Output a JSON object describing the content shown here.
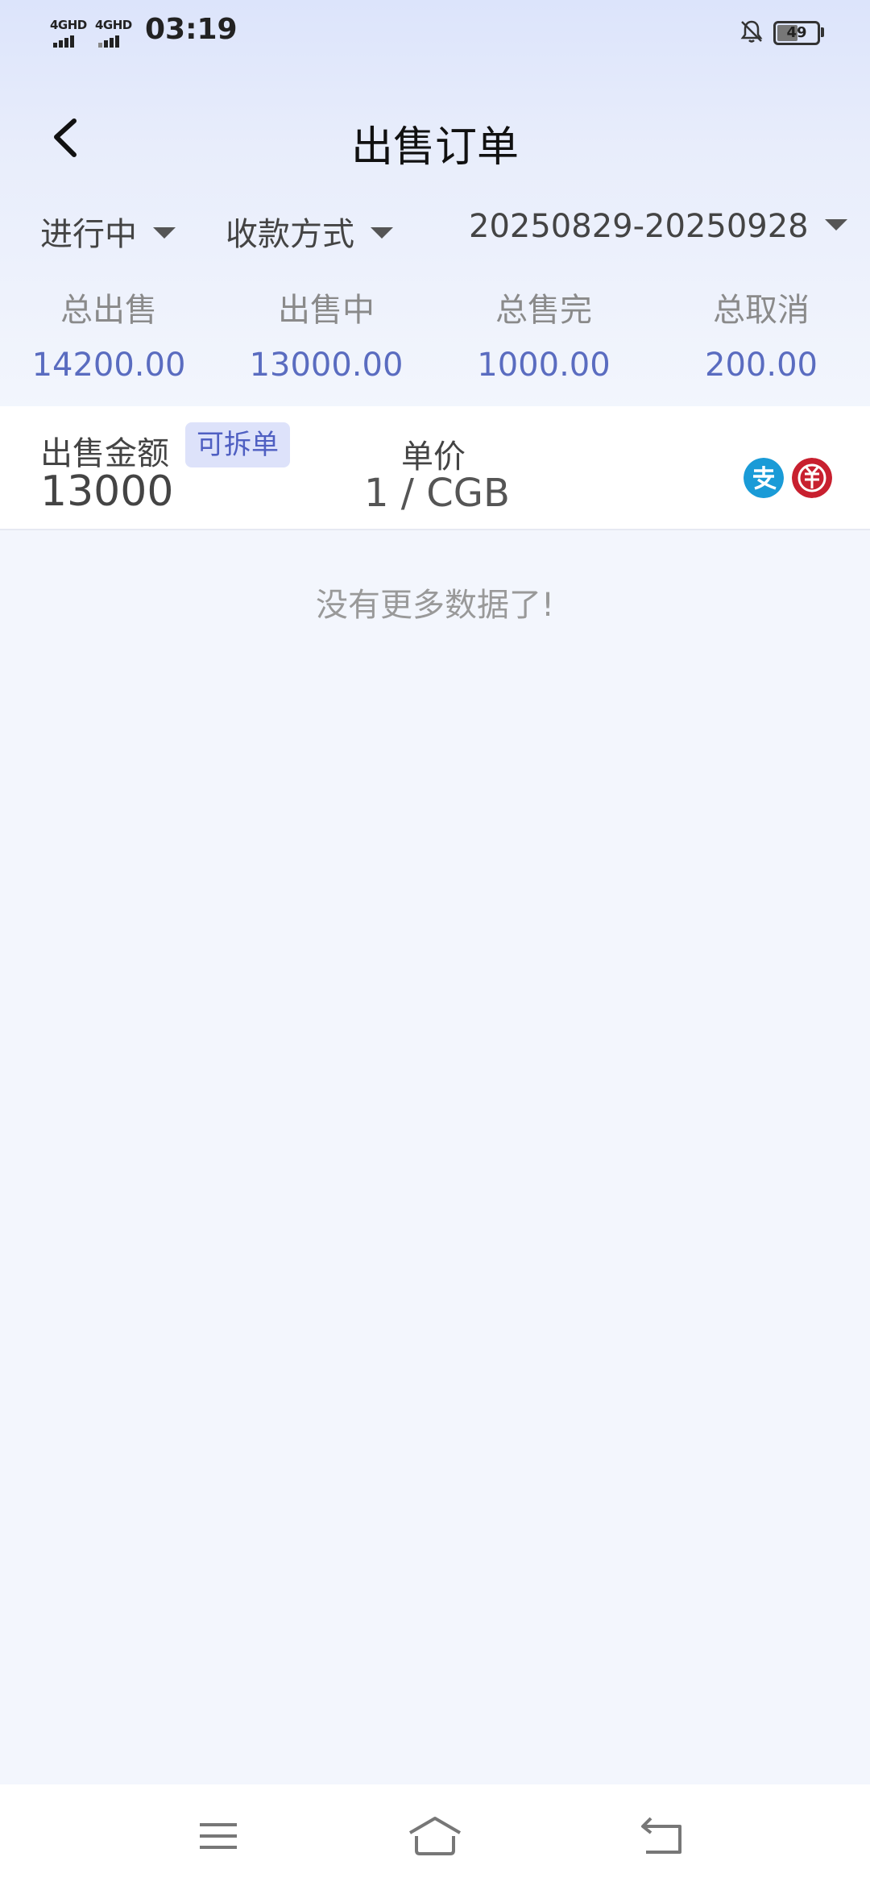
{
  "status_bar": {
    "network_1": "4GHD",
    "network_2": "4GHD",
    "time": "03:19",
    "battery": "49"
  },
  "header": {
    "title": "出售订单"
  },
  "filters": {
    "status": "进行中",
    "payment_method": "收款方式",
    "date_range": "20250829-20250928"
  },
  "stats": [
    {
      "label": "总出售",
      "value": "14200.00"
    },
    {
      "label": "出售中",
      "value": "13000.00"
    },
    {
      "label": "总售完",
      "value": "1000.00"
    },
    {
      "label": "总取消",
      "value": "200.00"
    }
  ],
  "order": {
    "amount_label": "出售金额",
    "split_tag": "可拆单",
    "amount_value": "13000",
    "price_label": "单价",
    "price_value": "1 / CGB",
    "payment_icons": [
      "alipay-icon",
      "unionpay-icon"
    ]
  },
  "list_end_text": "没有更多数据了!",
  "colors": {
    "accent": "#5a6cc0",
    "alipay": "#1a9bd7",
    "unionpay": "#c8202f"
  }
}
